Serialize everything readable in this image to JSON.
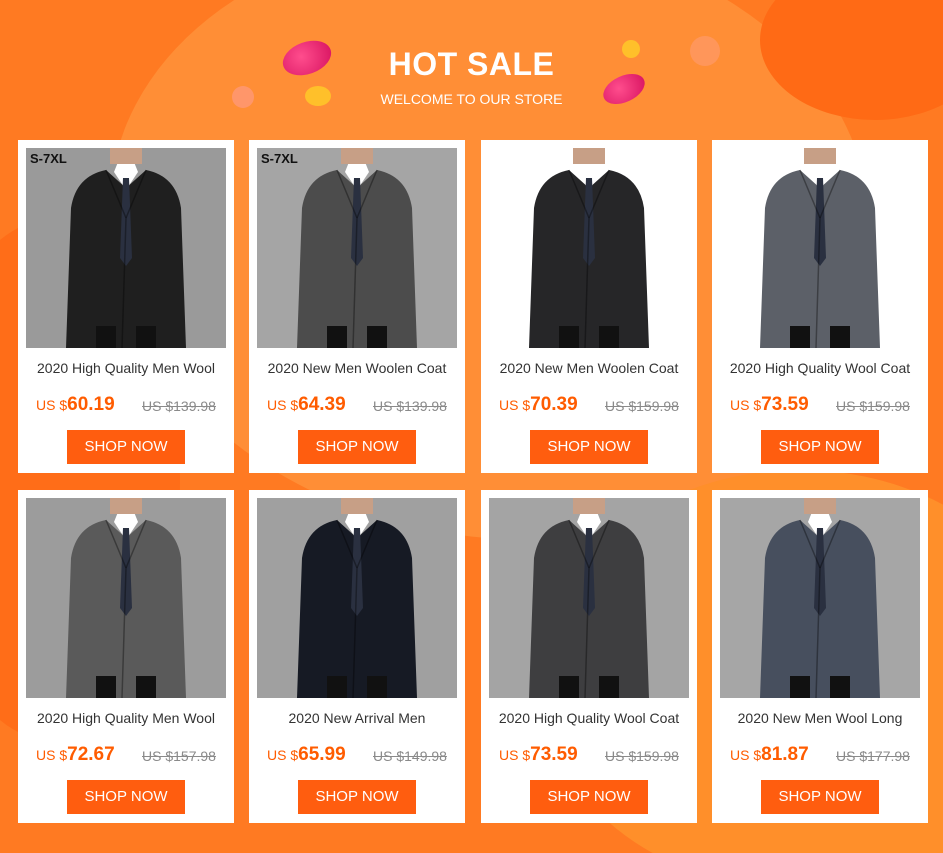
{
  "header": {
    "title": "HOT SALE",
    "subtitle": "WELCOME TO OUR STORE"
  },
  "products": [
    {
      "name": "2020 High Quality Men Wool",
      "currency": "US $",
      "price": "60.19",
      "old_price": "US $139.98",
      "size_tag": "S-7XL",
      "button": "SHOP NOW",
      "coat_color": "#1f1f1f",
      "photo_bg": "#9a9a9a"
    },
    {
      "name": "2020 New Men Woolen Coat",
      "currency": "US $",
      "price": "64.39",
      "old_price": "US $139.98",
      "size_tag": "S-7XL",
      "button": "SHOP NOW",
      "coat_color": "#4c4c4c",
      "photo_bg": "#a5a5a5"
    },
    {
      "name": "2020 New Men Woolen Coat",
      "currency": "US $",
      "price": "70.39",
      "old_price": "US $159.98",
      "size_tag": "",
      "button": "SHOP NOW",
      "coat_color": "#262628",
      "photo_bg": "#ffffff"
    },
    {
      "name": "2020 High Quality Wool Coat",
      "currency": "US $",
      "price": "73.59",
      "old_price": "US $159.98",
      "size_tag": "",
      "button": "SHOP NOW",
      "coat_color": "#5c6068",
      "photo_bg": "#ffffff"
    },
    {
      "name": "2020 High Quality Men Wool",
      "currency": "US $",
      "price": "72.67",
      "old_price": "US $157.98",
      "size_tag": "",
      "button": "SHOP NOW",
      "coat_color": "#5a5a5a",
      "photo_bg": "#9c9c9c"
    },
    {
      "name": "2020 New Arrival Men",
      "currency": "US $",
      "price": "65.99",
      "old_price": "US $149.98",
      "size_tag": "",
      "button": "SHOP NOW",
      "coat_color": "#161a24",
      "photo_bg": "#a0a0a0"
    },
    {
      "name": "2020 High Quality Wool Coat",
      "currency": "US $",
      "price": "73.59",
      "old_price": "US $159.98",
      "size_tag": "",
      "button": "SHOP NOW",
      "coat_color": "#3e3e40",
      "photo_bg": "#a4a4a4"
    },
    {
      "name": "2020 New Men Wool Long",
      "currency": "US $",
      "price": "81.87",
      "old_price": "US $177.98",
      "size_tag": "",
      "button": "SHOP NOW",
      "coat_color": "#474f5e",
      "photo_bg": "#a6a6a6"
    }
  ]
}
